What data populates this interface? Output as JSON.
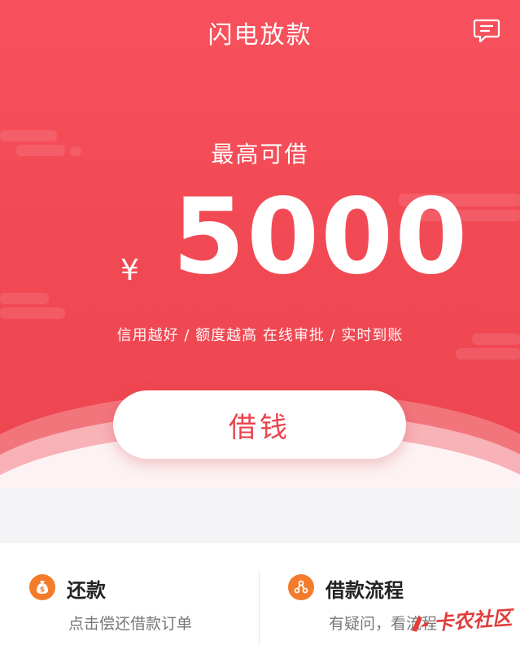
{
  "header": {
    "title": "闪电放款",
    "message_icon": "chat-bubble-icon"
  },
  "hero": {
    "subtitle": "最高可借",
    "currency": "¥",
    "amount": "5000",
    "slogan": "信用越好 / 额度越高 在线审批 / 实时到账",
    "borrow_button": "借钱"
  },
  "cards": [
    {
      "title": "还款",
      "desc": "点击偿还借款订单",
      "icon": "money-bag-icon"
    },
    {
      "title": "借款流程",
      "desc": "有疑问，看流程",
      "icon": "flow-icon"
    }
  ],
  "watermark": {
    "text": "卡农社区"
  },
  "colors": {
    "primary": "#f04a55",
    "accent": "#f47b2a",
    "background": "#f4f4f6"
  }
}
